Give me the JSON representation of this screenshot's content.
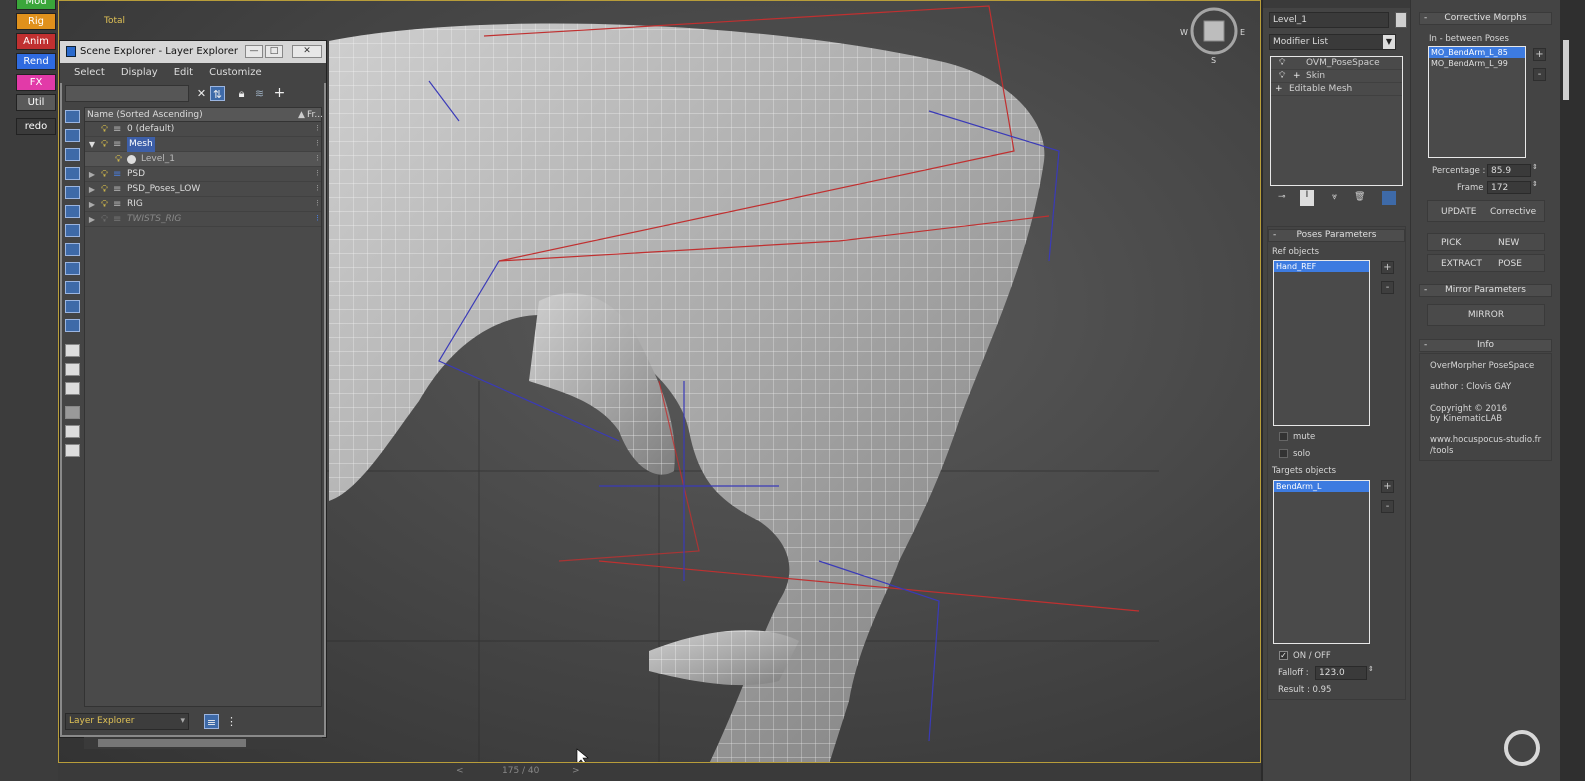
{
  "quick_buttons": [
    {
      "label": "Mod",
      "color": "#3aa63a"
    },
    {
      "label": "Rig",
      "color": "#e0911c"
    },
    {
      "label": "Anim",
      "color": "#c03030"
    },
    {
      "label": "Rend",
      "color": "#2f6be0"
    },
    {
      "label": "FX",
      "color": "#e23aa8"
    },
    {
      "label": "Util",
      "color": "#5a5a5a"
    },
    {
      "label": "redo",
      "color": "#3a3a3a"
    }
  ],
  "viewport": {
    "total_label": "Total",
    "viewcube": {
      "w": "W",
      "e": "E",
      "s": "S"
    },
    "time_slider": "175 / 40",
    "time_prev": "<",
    "time_next": ">"
  },
  "scene_explorer": {
    "title": "Scene Explorer - Layer Explorer",
    "window_buttons": {
      "minimize": "—",
      "maximize": "□",
      "close": "✕"
    },
    "menu": [
      "Select",
      "Display",
      "Edit",
      "Customize"
    ],
    "column_name": "Name (Sorted Ascending)",
    "column_freeze": "Fr...",
    "sort_arrow": "▲",
    "layers": [
      {
        "name": "0 (default)",
        "expanded": false,
        "has_children": false,
        "indent": 0,
        "selected": false
      },
      {
        "name": "Mesh",
        "expanded": true,
        "has_children": true,
        "indent": 0,
        "selected": true
      },
      {
        "name": "Level_1",
        "expanded": false,
        "has_children": false,
        "indent": 1,
        "selected": false
      },
      {
        "name": "PSD",
        "expanded": false,
        "has_children": true,
        "indent": 0,
        "selected": false
      },
      {
        "name": "PSD_Poses_LOW",
        "expanded": false,
        "has_children": true,
        "indent": 0,
        "selected": false
      },
      {
        "name": "RIG",
        "expanded": false,
        "has_children": true,
        "indent": 0,
        "selected": false
      },
      {
        "name": "TWISTS_RIG",
        "expanded": false,
        "has_children": true,
        "indent": 0,
        "selected": false,
        "hidden": true
      }
    ],
    "explorer_select": "Layer Explorer"
  },
  "command_panel": {
    "object_name": "Level_1",
    "modifier_list": "Modifier List",
    "modifier_stack": [
      "OVM_PoseSpace",
      "Skin",
      "Editable Mesh"
    ],
    "poses_parameters": {
      "header": "Poses Parameters",
      "ref_objects_label": "Ref objects",
      "ref_objects": [
        "Hand_REF"
      ],
      "mute": "mute",
      "solo": "solo",
      "targets_label": "Targets objects",
      "targets": [
        "BendArm_L"
      ],
      "on_off": "ON / OFF",
      "falloff_label": "Falloff :",
      "falloff_value": "123.0",
      "result": "Result : 0.95"
    }
  },
  "corrective_panel": {
    "header": "Corrective Morphs",
    "list_header": "In - between  Poses",
    "morphs": [
      "MO_BendArm_L_85",
      "MO_BendArm_L_99"
    ],
    "percentage_label": "Percentage :",
    "percentage_value": "85.9",
    "frame_label": "Frame :",
    "frame_value": "172",
    "buttons_row1": [
      "UPDATE",
      "Corrective"
    ],
    "buttons_row2": [
      "PICK",
      "NEW"
    ],
    "buttons_row3": [
      "EXTRACT",
      "POSE"
    ],
    "mirror_header": "Mirror Parameters",
    "mirror_button": "MIRROR",
    "info_header": "Info",
    "info_lines": [
      "OverMorpher PoseSpace",
      "author : Clovis GAY",
      "Copyright © 2016",
      "by KinematicLAB",
      "www.hocuspocus-studio.fr",
      "/tools"
    ]
  }
}
